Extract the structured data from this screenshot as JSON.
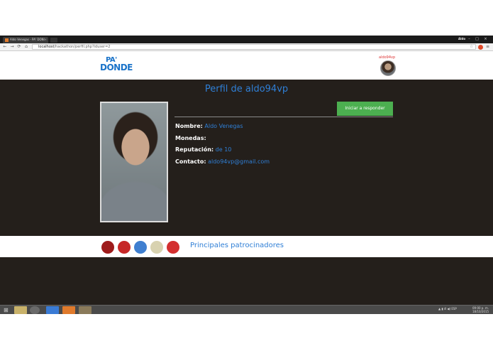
{
  "browser": {
    "tab_title": "Aldo Venegas - PA' DONI",
    "tab_close": "×",
    "user": "Aldo",
    "url_host": "localhost",
    "url_path": "/hackathon/perfil.php?iduser=2",
    "buttons": {
      "minimize": "–",
      "maximize": "□",
      "close": "×",
      "back": "←",
      "forward": "→",
      "reload": "⟳",
      "home": "⌂",
      "bookmark": "☆",
      "menu": "≡"
    }
  },
  "site": {
    "logo_top": "PA'",
    "logo_bottom": "DONDE",
    "nav_username": "aldo94vp"
  },
  "profile": {
    "title": "Perfil de aldo94vp",
    "start_button": "Iniciar a responder",
    "fields": [
      {
        "key": "Nombre:",
        "value": "Aldo Venegas"
      },
      {
        "key": "Monedas:",
        "value": ""
      },
      {
        "key": "Reputación:",
        "value": "de 10"
      },
      {
        "key": "Contacto:",
        "value": "aldo94vp@gmail.com"
      }
    ]
  },
  "sponsors": {
    "title": "Principales patrocinadores",
    "colors": [
      "#9e1b1b",
      "#c62828",
      "#3f7fd0",
      "#d8d2b0",
      "#d32f2f"
    ]
  },
  "taskbar": {
    "start_glyph": "⊞",
    "tray_text": "▲ ▮ ıll ◀) ESP",
    "time": "09:00 p. m.",
    "date": "18/10/2015"
  }
}
